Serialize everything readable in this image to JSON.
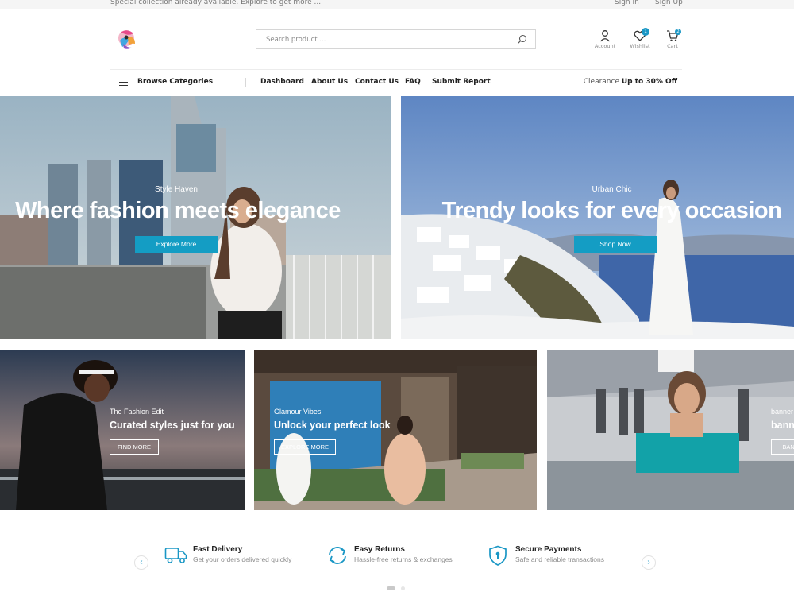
{
  "topbar": {
    "promo": "Special collection already available. Explore to get more ...",
    "sign_in": "Sign In",
    "sign_up": "Sign Up"
  },
  "header": {
    "search_placeholder": "Search product ...",
    "account_label": "Account",
    "wishlist_label": "Wishlist",
    "wishlist_count": "1",
    "cart_label": "Cart",
    "cart_count": "2"
  },
  "nav": {
    "browse_label": "Browse Categories",
    "links": [
      "Dashboard",
      "About Us",
      "Contact Us",
      "FAQ",
      "Submit Report"
    ],
    "clearance_label": "Clearance",
    "clearance_offer": "Up to 30% Off"
  },
  "heroes": [
    {
      "kicker": "Style Haven",
      "headline": "Where fashion meets elegance",
      "cta": "Explore More"
    },
    {
      "kicker": "Urban Chic",
      "headline": "Trendy looks for every occasion",
      "cta": "Shop Now"
    }
  ],
  "cards": [
    {
      "kicker": "The Fashion Edit",
      "title": "Curated styles just for you",
      "cta": "FIND MORE"
    },
    {
      "kicker": "Glamour Vibes",
      "title": "Unlock your perfect look",
      "cta": "EXPLORE MORE"
    },
    {
      "kicker": "banner",
      "title": "banner",
      "cta": "BANNER"
    }
  ],
  "features": [
    {
      "title": "Fast Delivery",
      "desc": "Get your orders delivered quickly",
      "icon": "truck-icon"
    },
    {
      "title": "Easy Returns",
      "desc": "Hassle-free returns & exchanges",
      "icon": "returns-icon"
    },
    {
      "title": "Secure Payments",
      "desc": "Safe and reliable transactions",
      "icon": "shield-lock-icon"
    }
  ],
  "carousel": {
    "prev_symbol": "‹",
    "next_symbol": "›"
  },
  "colors": {
    "accent": "#149dc4",
    "text": "#222222",
    "muted": "#8d8d8d"
  }
}
